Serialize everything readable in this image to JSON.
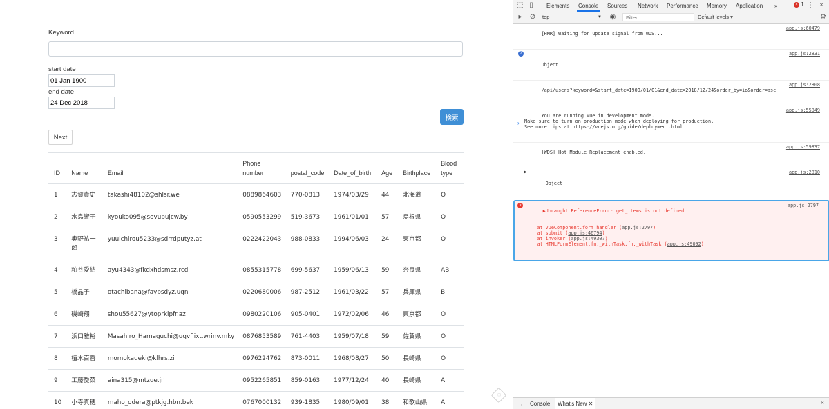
{
  "form": {
    "keyword_label": "Keyword",
    "keyword_value": "",
    "start_date_label": "start date",
    "start_date_value": "01 Jan 1900",
    "end_date_label": "end date",
    "end_date_value": "24 Dec 2018",
    "search_button": "検索",
    "next_button": "Next"
  },
  "table": {
    "headers": [
      "ID",
      "Name",
      "Email",
      "Phone number",
      "postal_code",
      "Date_of_birth",
      "Age",
      "Birthplace",
      "Blood type"
    ],
    "rows": [
      [
        "1",
        "志賀貴史",
        "takashi48102@shlsr.we",
        "0889864603",
        "770-0813",
        "1974/03/29",
        "44",
        "北海道",
        "O"
      ],
      [
        "2",
        "水島響子",
        "kyouko095@sovupujcw.by",
        "0590553299",
        "519-3673",
        "1961/01/01",
        "57",
        "島根県",
        "O"
      ],
      [
        "3",
        "奥野祐一郎",
        "yuuichirou5233@sdrrdputyz.at",
        "0222422043",
        "988-0833",
        "1994/06/03",
        "24",
        "東京都",
        "O"
      ],
      [
        "4",
        "粕谷愛結",
        "ayu4343@fkdxhdsmsz.rcd",
        "0855315778",
        "699-5637",
        "1959/06/13",
        "59",
        "奈良県",
        "AB"
      ],
      [
        "5",
        "橋晶子",
        "otachibana@faybsdyz.uqn",
        "0220680006",
        "987-2512",
        "1961/03/22",
        "57",
        "兵庫県",
        "B"
      ],
      [
        "6",
        "磯崎翔",
        "shou55627@ytoprkipfr.az",
        "0980220106",
        "905-0401",
        "1972/02/06",
        "46",
        "東京都",
        "O"
      ],
      [
        "7",
        "浜口雅裕",
        "Masahiro_Hamaguchi@uqvflixt.wrinv.mky",
        "0876853589",
        "761-4403",
        "1959/07/18",
        "59",
        "佐賀県",
        "O"
      ],
      [
        "8",
        "植木百香",
        "momokaueki@klhrs.zi",
        "0976224762",
        "873-0011",
        "1968/08/27",
        "50",
        "長崎県",
        "O"
      ],
      [
        "9",
        "工藤愛菜",
        "aina315@mtzue.jr",
        "0952265851",
        "859-0163",
        "1977/12/24",
        "40",
        "長崎県",
        "A"
      ],
      [
        "10",
        "小寺真穂",
        "maho_odera@ptkjg.hbn.bek",
        "0767000132",
        "939-1835",
        "1980/09/01",
        "38",
        "和歌山県",
        "A"
      ]
    ]
  },
  "devtools": {
    "tabs": [
      "Elements",
      "Console",
      "Sources",
      "Network",
      "Performance",
      "Memory",
      "Application"
    ],
    "active_tab": "Console",
    "more_tabs": "»",
    "error_count": "1",
    "context": "top",
    "filter_placeholder": "Filter",
    "levels": "Default levels ▾",
    "messages": [
      {
        "text": "[HMR] Waiting for update signal from WDS...",
        "src": "app.js:60479"
      },
      {
        "text": "Object",
        "src": "app.js:2831",
        "badge": "2"
      },
      {
        "text": "/api/users?keyword=&start_date=1900/01/01&end_date=2018/12/24&order_by=id&order=asc",
        "src": "app.js:2808"
      },
      {
        "text": "You are running Vue in development mode.\nMake sure to turn on production mode when deploying for production.\nSee more tips at https://vuejs.org/guide/deployment.html",
        "src": "app.js:55849"
      },
      {
        "text": "[WDS] Hot Module Replacement enabled.",
        "src": "app.js:59837"
      },
      {
        "text": "Object",
        "src": "app.js:2810"
      }
    ],
    "error": {
      "title": "Uncaught ReferenceError: get_items is not defined",
      "src": "app.js:2797",
      "stack": [
        {
          "pre": "    at VueComponent.form_handler (",
          "link": "app.js:2797",
          "post": ")"
        },
        {
          "pre": "    at submit (",
          "link": "app.js:46794",
          "post": ")"
        },
        {
          "pre": "    at invoker (",
          "link": "app.js:49307",
          "post": ")"
        },
        {
          "pre": "    at HTMLFormElement.fn._withTask.fn._withTask (",
          "link": "app.js:49092",
          "post": ")"
        }
      ]
    },
    "prompt": "›",
    "drawer_tabs": [
      "Console",
      "What's New"
    ],
    "drawer_close": "×"
  }
}
